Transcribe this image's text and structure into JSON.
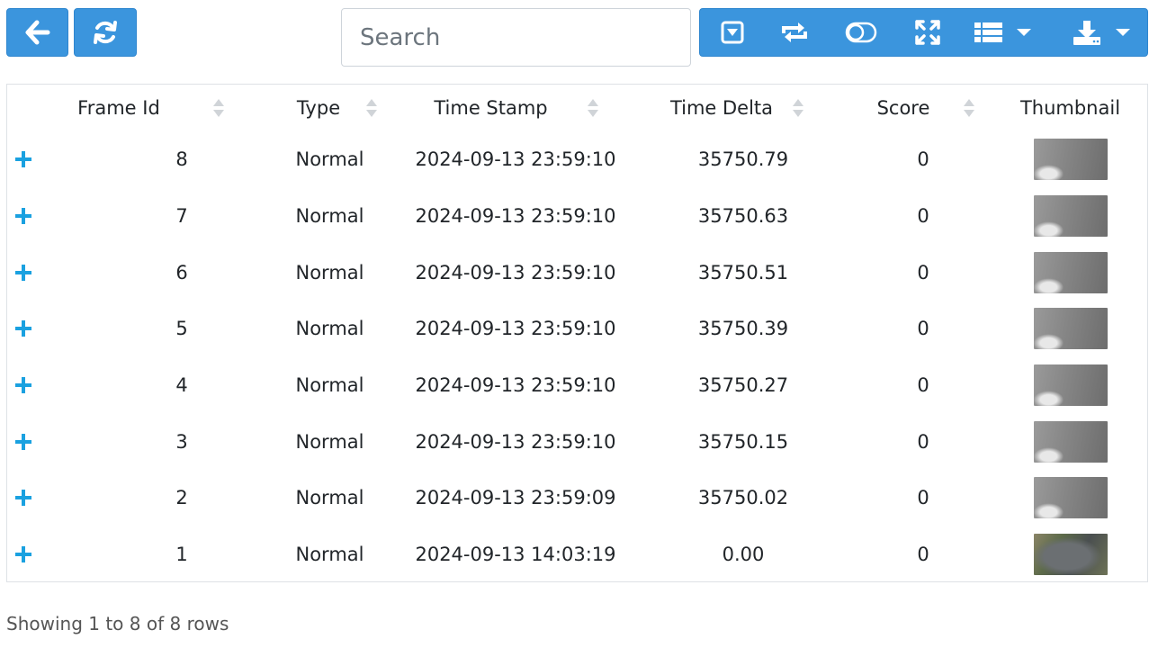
{
  "search": {
    "placeholder": "Search"
  },
  "toolbar": {
    "back_icon": "arrow-left-icon",
    "refresh_icon": "refresh-icon",
    "group_icons": [
      "toggle-filter-icon",
      "repeat-icon",
      "toggle-icon",
      "fullscreen-icon",
      "columns-list-icon",
      "download-icon"
    ]
  },
  "table": {
    "columns": [
      "Frame Id",
      "Type",
      "Time Stamp",
      "Time Delta",
      "Score",
      "Thumbnail"
    ],
    "rows": [
      {
        "frame_id": "8",
        "type": "Normal",
        "time_stamp": "2024-09-13 23:59:10",
        "time_delta": "35750.79",
        "score": "0"
      },
      {
        "frame_id": "7",
        "type": "Normal",
        "time_stamp": "2024-09-13 23:59:10",
        "time_delta": "35750.63",
        "score": "0"
      },
      {
        "frame_id": "6",
        "type": "Normal",
        "time_stamp": "2024-09-13 23:59:10",
        "time_delta": "35750.51",
        "score": "0"
      },
      {
        "frame_id": "5",
        "type": "Normal",
        "time_stamp": "2024-09-13 23:59:10",
        "time_delta": "35750.39",
        "score": "0"
      },
      {
        "frame_id": "4",
        "type": "Normal",
        "time_stamp": "2024-09-13 23:59:10",
        "time_delta": "35750.27",
        "score": "0"
      },
      {
        "frame_id": "3",
        "type": "Normal",
        "time_stamp": "2024-09-13 23:59:10",
        "time_delta": "35750.15",
        "score": "0"
      },
      {
        "frame_id": "2",
        "type": "Normal",
        "time_stamp": "2024-09-13 23:59:09",
        "time_delta": "35750.02",
        "score": "0"
      },
      {
        "frame_id": "1",
        "type": "Normal",
        "time_stamp": "2024-09-13 14:03:19",
        "time_delta": "0.00",
        "score": "0"
      }
    ]
  },
  "footer": {
    "text": "Showing 1 to 8 of 8 rows"
  },
  "colors": {
    "accent": "#3b95dd",
    "expand": "#1aa1e0"
  }
}
